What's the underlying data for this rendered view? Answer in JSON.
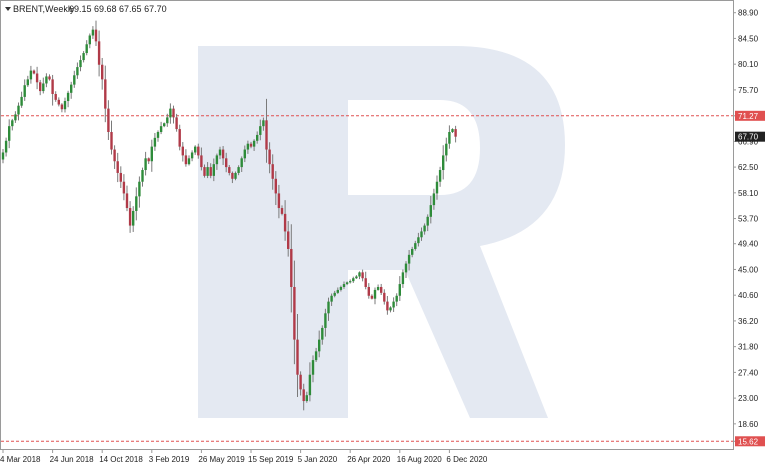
{
  "header": {
    "symbol_line": "BRENT,Weekly",
    "ohlc_line": "69.15 69.68 67.65 67.70"
  },
  "colors": {
    "background": "#ffffff",
    "bull": "#2e8b3a",
    "bear": "#b03a48",
    "wick": "#7a7a7a",
    "hline": "#e05050",
    "axis": "#9a9a9a",
    "text": "#222222",
    "current_badge": "#222222",
    "watermark": "#e4e9f2"
  },
  "chart_data": {
    "type": "candlestick",
    "symbol": "BRENT",
    "timeframe": "Weekly",
    "ylim": [
      14.3,
      90.9
    ],
    "y_ticks": [
      "88.90",
      "84.50",
      "80.10",
      "75.70",
      "71.27",
      "66.90",
      "62.50",
      "58.10",
      "53.70",
      "49.40",
      "45.00",
      "40.60",
      "36.20",
      "31.80",
      "27.40",
      "23.00",
      "18.60",
      "15.62"
    ],
    "x_ticks": [
      "4 Mar 2018",
      "24 Jun 2018",
      "14 Oct 2018",
      "3 Feb 2019",
      "26 May 2019",
      "15 Sep 2019",
      "5 Jan 2020",
      "26 Apr 2020",
      "16 Aug 2020",
      "6 Dec 2020"
    ],
    "x_tick_index": [
      0,
      16,
      32,
      48,
      64,
      80,
      96,
      112,
      128,
      144
    ],
    "horizontal_lines": [
      {
        "value": "71.27"
      },
      {
        "value": "15.62"
      }
    ],
    "current_price": "67.70",
    "closes": [
      65.0,
      67.0,
      69.5,
      70.5,
      71.5,
      73.0,
      74.5,
      76.5,
      77.5,
      79.0,
      78.5,
      77.0,
      75.5,
      76.8,
      78.0,
      77.5,
      75.0,
      74.0,
      73.2,
      72.4,
      73.8,
      75.2,
      76.6,
      78.2,
      79.6,
      80.8,
      82.0,
      83.5,
      85.0,
      86.0,
      84.0,
      80.0,
      77.5,
      72.5,
      68.5,
      65.5,
      63.5,
      61.5,
      60.0,
      58.0,
      55.5,
      52.5,
      55.0,
      57.5,
      60.0,
      62.0,
      64.0,
      63.5,
      66.0,
      67.5,
      68.5,
      69.5,
      70.0,
      71.0,
      72.5,
      71.0,
      69.0,
      66.0,
      64.5,
      63.0,
      64.0,
      65.0,
      66.0,
      64.5,
      62.5,
      61.0,
      62.5,
      61.0,
      63.0,
      64.5,
      65.5,
      64.0,
      62.5,
      61.5,
      60.5,
      61.5,
      62.5,
      64.0,
      65.5,
      66.5,
      66.0,
      67.0,
      68.0,
      69.5,
      70.5,
      65.5,
      63.0,
      60.5,
      58.0,
      55.5,
      54.5,
      51.5,
      48.5,
      42.0,
      33.0,
      27.0,
      24.5,
      22.5,
      23.5,
      27.0,
      29.5,
      31.0,
      33.0,
      35.0,
      37.5,
      39.5,
      40.5,
      41.0,
      41.5,
      42.0,
      42.5,
      42.8,
      43.0,
      43.5,
      43.8,
      44.5,
      43.5,
      42.0,
      40.5,
      40.0,
      41.5,
      42.0,
      41.0,
      39.5,
      38.0,
      38.5,
      39.5,
      40.5,
      42.5,
      44.5,
      46.0,
      47.5,
      48.5,
      49.5,
      50.5,
      51.5,
      52.5,
      54.0,
      56.0,
      58.0,
      60.0,
      62.0,
      64.5,
      66.5,
      68.5,
      69.0,
      67.7
    ]
  }
}
